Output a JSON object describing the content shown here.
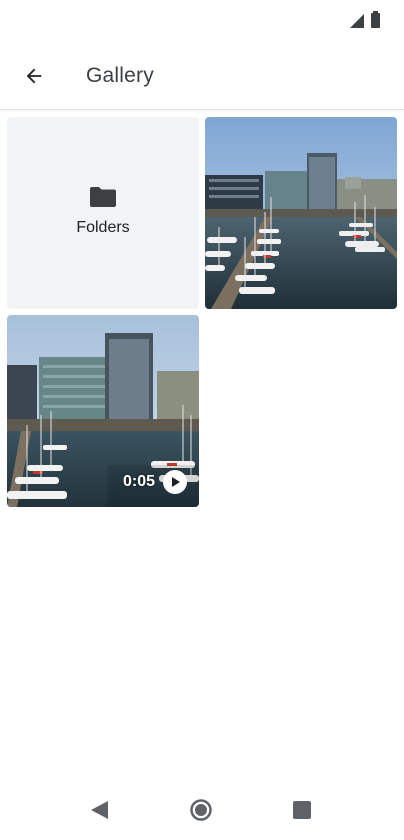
{
  "app_bar": {
    "title": "Gallery",
    "back_icon": "arrow-back-icon"
  },
  "status_bar": {
    "icons": [
      "signal-icon",
      "battery-icon"
    ]
  },
  "grid": {
    "folders_tile": {
      "label": "Folders",
      "icon": "folder-icon"
    },
    "photo_tile": {
      "subject": "marina with boats and office buildings"
    },
    "video_tile": {
      "duration": "0:05",
      "icon": "play-icon"
    }
  },
  "nav_bar": {
    "icons": [
      "nav-back-icon",
      "nav-home-icon",
      "nav-recents-icon"
    ]
  },
  "colors": {
    "background": "#ffffff",
    "tile_background": "#f1f3f4",
    "text": "#202124",
    "icon": "#3c4043"
  }
}
